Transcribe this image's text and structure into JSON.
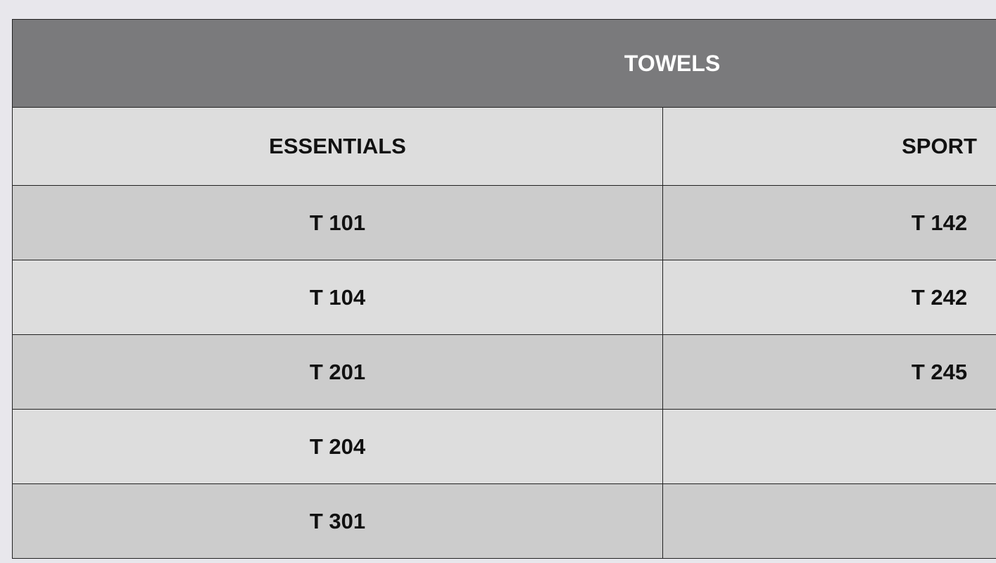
{
  "table": {
    "title": "TOWELS",
    "columns": [
      "ESSENTIALS",
      "SPORT"
    ],
    "rows": [
      [
        "T 101",
        "T 142"
      ],
      [
        "T 104",
        "T 242"
      ],
      [
        "T 201",
        "T 245"
      ],
      [
        "T 204",
        ""
      ],
      [
        "T 301",
        ""
      ]
    ]
  },
  "colors": {
    "page_background": "#e8e7ec",
    "title_background": "#7a7a7c",
    "row_light": "#dddddd",
    "row_dark": "#cccccc",
    "border": "#222222"
  }
}
